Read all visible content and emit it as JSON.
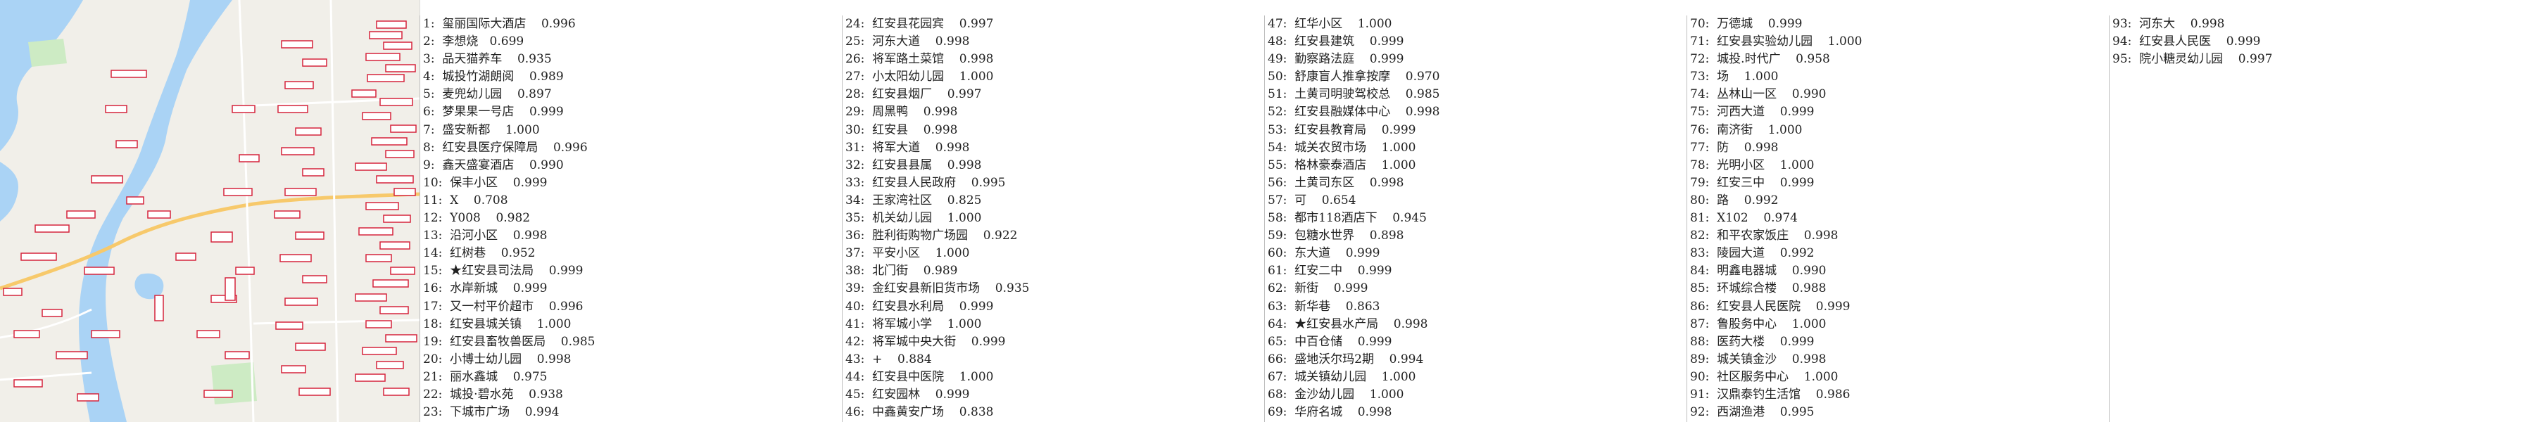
{
  "map": {
    "water_color": "#aad3f5",
    "land_color": "#f1efe9",
    "green_color": "#cdebc4",
    "road_color": "#ffffff",
    "highway_color": "#f7c96b",
    "box_color": "#d6243c"
  },
  "columns": [
    {
      "rows": [
        "1:  玺丽国际大酒店    0.996",
        "2:  李想烧   0.699",
        "3:  品天猫养车    0.935",
        "4:  城投竹湖朗阅    0.989",
        "5:  麦兜幼儿园    0.897",
        "6:  梦果果一号店    0.999",
        "7:  盛安新都    1.000",
        "8:  红安县医疗保障局    0.996",
        "9:  鑫天盛宴酒店    0.990",
        "10:  保丰小区    0.999",
        "11:  X    0.708",
        "12:  Y008    0.982",
        "13:  沿河小区    0.998",
        "14:  红树巷    0.952",
        "15:  ★红安县司法局    0.999",
        "16:  水岸新城    0.999",
        "17:  又一村平价超市    0.996",
        "18:  红安县城关镇    1.000",
        "19:  红安县畜牧兽医局    0.985",
        "20:  小博士幼儿园    0.998",
        "21:  丽水鑫城    0.975",
        "22:  城投·碧水苑    0.938",
        "23:  下城市广场    0.994"
      ]
    },
    {
      "rows": [
        "24:  红安县花园宾    0.997",
        "25:  河东大道    0.998",
        "26:  将军路土菜馆    0.998",
        "27:  小太阳幼儿园    1.000",
        "28:  红安县烟厂    0.997",
        "29:  周黑鸭    0.998",
        "30:  红安县    0.998",
        "31:  将军大道    0.998",
        "32:  红安县县属    0.998",
        "33:  红安县人民政府    0.995",
        "34:  王家湾社区    0.825",
        "35:  机关幼儿园    1.000",
        "36:  胜利街购物广场园    0.922",
        "37:  平安小区    1.000",
        "38:  北门街    0.989",
        "39:  金红安县新旧货市场    0.935",
        "40:  红安县水利局    0.999",
        "41:  将军城小学    1.000",
        "42:  将军城中央大街    0.999",
        "43:  +    0.884",
        "44:  红安县中医院    1.000",
        "45:  红安园林    0.999",
        "46:  中鑫黄安广场    0.838"
      ]
    },
    {
      "rows": [
        "47:  红华小区    1.000",
        "48:  红安县建筑    0.999",
        "49:  勤察路法庭    0.999",
        "50:  舒康盲人推拿按摩    0.970",
        "51:  土黄司明驶驾校总    0.985",
        "52:  红安县融媒体中心    0.998",
        "53:  红安县教育局    0.999",
        "54:  城关农贸市场    1.000",
        "55:  格林豪泰酒店    1.000",
        "56:  土黄司东区    0.998",
        "57:  可    0.654",
        "58:  都市118酒店下    0.945",
        "59:  包糖水世界    0.898",
        "60:  东大道    0.999",
        "61:  红安二中    0.999",
        "62:  新街    0.999",
        "63:  新华巷    0.863",
        "64:  ★红安县水产局    0.998",
        "65:  中百仓储    0.999",
        "66:  盛地沃尔玛2期    0.994",
        "67:  城关镇幼儿园    1.000",
        "68:  金沙幼儿园    1.000",
        "69:  华府名城    0.998"
      ]
    },
    {
      "rows": [
        "70:  万德城    0.999",
        "71:  红安县实验幼儿园    1.000",
        "72:  城投.时代广    0.958",
        "73:  场    1.000",
        "74:  丛林山一区    0.990",
        "75:  河西大道    0.999",
        "76:  南济街    1.000",
        "77:  防    0.998",
        "78:  光明小区    1.000",
        "79:  红安三中    0.999",
        "80:  路    0.992",
        "81:  X102    0.974",
        "82:  和平农家饭庄    0.998",
        "83:  陵园大道    0.992",
        "84:  明鑫电器城    0.990",
        "85:  环城综合楼    0.988",
        "86:  红安县人民医院    0.999",
        "87:  鲁股务中心    1.000",
        "88:  医药大楼    0.999",
        "89:  城关镇金沙    0.998",
        "90:  社区服务中心    1.000",
        "91:  汉鼎泰钓生活馆    0.986",
        "92:  西湖渔港    0.995"
      ]
    },
    {
      "rows": [
        "93:  河东大    0.998",
        "94:  红安县人民医    0.999",
        "95:  院小糖灵幼儿园    0.997"
      ]
    }
  ]
}
